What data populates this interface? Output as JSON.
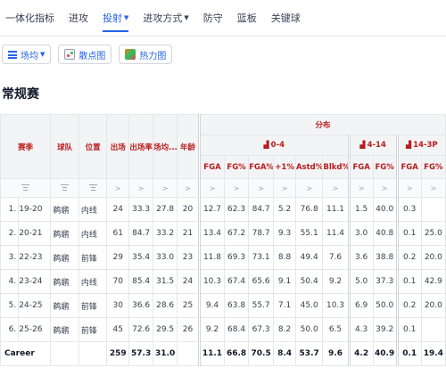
{
  "nav": {
    "items": [
      {
        "label": "一体化指标",
        "active": false,
        "dropdown": false
      },
      {
        "label": "进攻",
        "active": false,
        "dropdown": false
      },
      {
        "label": "投射",
        "active": true,
        "dropdown": true
      },
      {
        "label": "进攻方式",
        "active": false,
        "dropdown": true
      },
      {
        "label": "防守",
        "active": false,
        "dropdown": false
      },
      {
        "label": "篮板",
        "active": false,
        "dropdown": false
      },
      {
        "label": "关键球",
        "active": false,
        "dropdown": false
      }
    ]
  },
  "toolbar": {
    "mode_label": "场均",
    "scatter_label": "散点图",
    "heatmap_label": "热力图"
  },
  "section_title": "常规赛",
  "table": {
    "group_header": "分布",
    "headers": {
      "season": "赛季",
      "team": "球队",
      "position": "位置",
      "games": "出场",
      "games_rate": "出场率",
      "minutes": "场均...",
      "age": "年龄"
    },
    "ranges": [
      "0-4",
      "4-14",
      "14-3P"
    ],
    "sub_headers": {
      "r0": [
        "FGA",
        "FG%",
        "FGA%",
        "+1%",
        "Astd%",
        "Blkd%"
      ],
      "r1": [
        "FGA",
        "FG%"
      ],
      "r2": [
        "FGA",
        "FG%"
      ]
    },
    "filter_arrow": ">",
    "rows": [
      {
        "idx": "1.",
        "season": "19-20",
        "team": "鹈鹕",
        "pos": "内线",
        "g": "24",
        "gr": "33.3",
        "min": "27.8",
        "age": "20",
        "a": [
          "12.7",
          "62.3",
          "84.7",
          "5.2",
          "76.8",
          "11.1"
        ],
        "b": [
          "1.5",
          "40.0"
        ],
        "c": [
          "0.3",
          ""
        ]
      },
      {
        "idx": "2.",
        "season": "20-21",
        "team": "鹈鹕",
        "pos": "内线",
        "g": "61",
        "gr": "84.7",
        "min": "33.2",
        "age": "21",
        "a": [
          "13.4",
          "67.2",
          "78.7",
          "9.3",
          "55.1",
          "11.4"
        ],
        "b": [
          "3.0",
          "40.8"
        ],
        "c": [
          "0.1",
          "25.0"
        ]
      },
      {
        "idx": "3.",
        "season": "22-23",
        "team": "鹈鹕",
        "pos": "前锋",
        "g": "29",
        "gr": "35.4",
        "min": "33.0",
        "age": "23",
        "a": [
          "11.8",
          "69.3",
          "73.1",
          "8.8",
          "49.4",
          "7.6"
        ],
        "b": [
          "3.6",
          "38.8"
        ],
        "c": [
          "0.2",
          "20.0"
        ]
      },
      {
        "idx": "4.",
        "season": "23-24",
        "team": "鹈鹕",
        "pos": "内线",
        "g": "70",
        "gr": "85.4",
        "min": "31.5",
        "age": "24",
        "a": [
          "10.3",
          "67.4",
          "65.6",
          "9.1",
          "50.4",
          "9.2"
        ],
        "b": [
          "5.0",
          "37.3"
        ],
        "c": [
          "0.1",
          "42.9"
        ]
      },
      {
        "idx": "5.",
        "season": "24-25",
        "team": "鹈鹕",
        "pos": "前锋",
        "g": "30",
        "gr": "36.6",
        "min": "28.6",
        "age": "25",
        "a": [
          "9.4",
          "63.8",
          "55.7",
          "7.1",
          "45.0",
          "10.3"
        ],
        "b": [
          "6.9",
          "50.0"
        ],
        "c": [
          "0.2",
          "20.0"
        ]
      },
      {
        "idx": "6.",
        "season": "25-26",
        "team": "鹈鹕",
        "pos": "前锋",
        "g": "45",
        "gr": "72.6",
        "min": "29.5",
        "age": "26",
        "a": [
          "9.2",
          "68.4",
          "67.3",
          "8.2",
          "50.0",
          "6.5"
        ],
        "b": [
          "4.3",
          "39.2"
        ],
        "c": [
          "0.1",
          ""
        ]
      }
    ],
    "career": {
      "label": "Career",
      "g": "259",
      "gr": "57.3",
      "min": "31.0",
      "a": [
        "11.1",
        "66.8",
        "70.5",
        "8.4",
        "53.7",
        "9.6"
      ],
      "b": [
        "4.2",
        "40.9"
      ],
      "c": [
        "0.1",
        "19.4"
      ]
    }
  },
  "colors": {
    "accent": "#2563eb",
    "header_text": "#b91c1c",
    "header_bg": "#f3f4f6"
  }
}
